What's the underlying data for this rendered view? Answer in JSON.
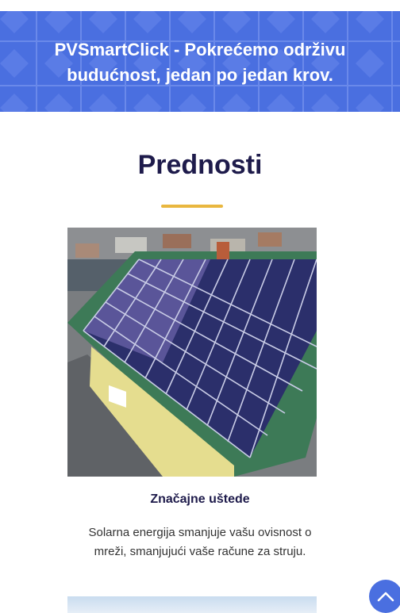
{
  "hero": {
    "title": "PVSmartClick - Pokrećemo održivu budućnost, jedan po jedan krov."
  },
  "benefits": {
    "heading": "Prednosti",
    "items": [
      {
        "image": "rooftop-solar-panels-image",
        "title": "Značajne uštede",
        "text": "Solarna energija smanjuje vašu ovisnost o mreži, smanjujući vaše račune za struju."
      }
    ]
  },
  "scroll_top": {
    "icon": "chevron-up-icon"
  },
  "colors": {
    "hero_bg": "#4a6fe0",
    "heading": "#1e1b4b",
    "accent_underline": "#e9b73f",
    "scroll_button": "#4a6fe0"
  }
}
